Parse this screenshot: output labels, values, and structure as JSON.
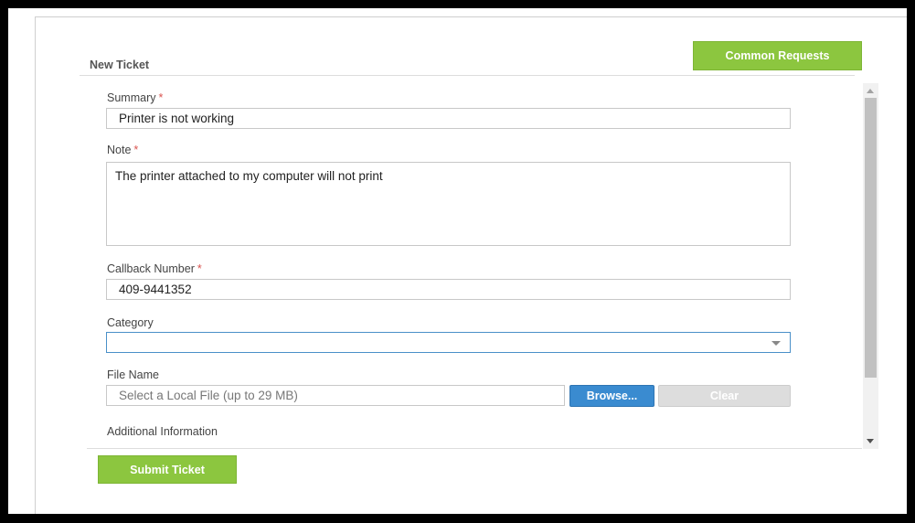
{
  "header": {
    "title": "New Ticket",
    "common_requests_label": "Common Requests"
  },
  "form": {
    "summary": {
      "label": "Summary",
      "required_mark": "*",
      "value": "Printer is not working"
    },
    "note": {
      "label": "Note",
      "required_mark": "*",
      "value": "The printer attached to my computer will not print"
    },
    "callback": {
      "label": "Callback Number",
      "required_mark": "*",
      "value": "409-9441352"
    },
    "category": {
      "label": "Category",
      "value": ""
    },
    "file": {
      "label": "File Name",
      "placeholder": "Select a Local File (up to 29 MB)",
      "browse_label": "Browse...",
      "clear_label": "Clear"
    },
    "additional": {
      "label": "Additional Information",
      "value": ""
    }
  },
  "footer": {
    "submit_label": "Submit Ticket"
  },
  "colors": {
    "accent_green": "#8cc63f",
    "browse_blue": "#3a8bd0",
    "required_red": "#d9534f"
  }
}
